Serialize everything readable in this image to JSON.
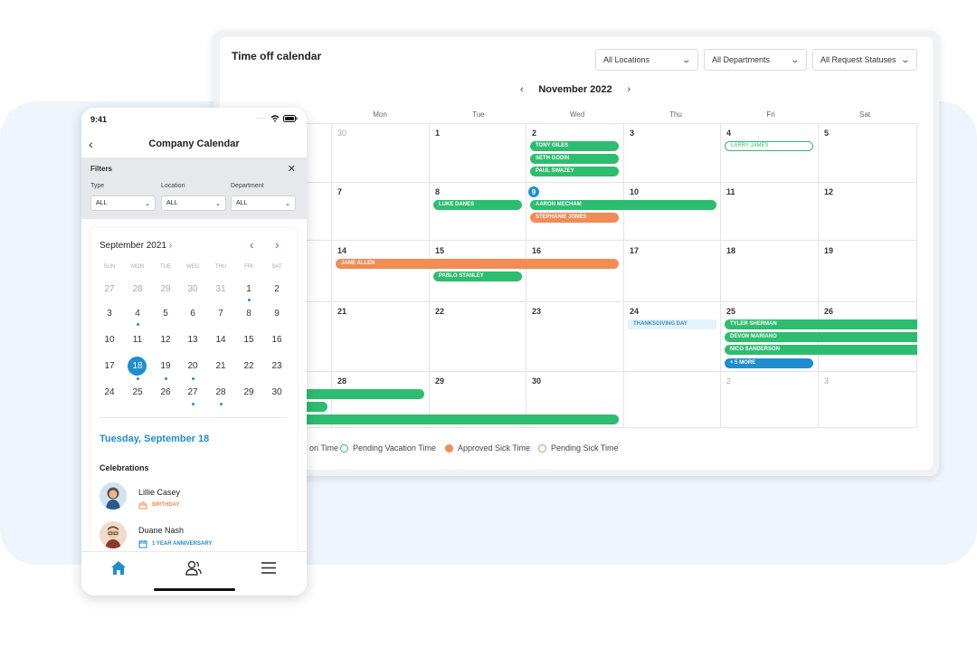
{
  "desktop": {
    "title": "Time off calendar",
    "filters": [
      "All Locations",
      "All Departments",
      "All Request Statuses"
    ],
    "month": "November 2022",
    "weekdays": [
      "Mon",
      "Tue",
      "Wed",
      "Thu",
      "Fri",
      "Sat"
    ],
    "weeks": [
      [
        "",
        "30",
        "1",
        "2",
        "3",
        "4",
        "5"
      ],
      [
        "",
        "7",
        "8",
        "9",
        "10",
        "11",
        "12"
      ],
      [
        "",
        "14",
        "15",
        "16",
        "17",
        "18",
        "19"
      ],
      [
        "",
        "21",
        "22",
        "23",
        "24",
        "25",
        "26"
      ],
      [
        "",
        "28",
        "29",
        "30",
        "",
        "2",
        "3"
      ]
    ],
    "events": {
      "tony_giles": "TONY GILES",
      "seth_godin": "SETH GODIN",
      "paul_swazey": "PAUL SWAZEY",
      "larry_james": "Larry James",
      "luke_danes": "LUKE DANES",
      "aaron_mecham": "AARON MECHAM",
      "stephanie_jones": "STEPHANIE JONES",
      "jane_allen": "JANE ALLEN",
      "pablo_stanley": "PABLO STANLEY",
      "thanksgiving": "THANKSGIVING DAY",
      "tyler_sherman": "TYLER SHERMAN",
      "devon_mariano": "DEVON MARIANO",
      "nico_sanderson": "NICO SANDERSON",
      "more": "+ 5 MORE"
    },
    "legend": [
      "on Time",
      "Pending Vacation Time",
      "Approved Sick Time",
      "Pending Sick Time"
    ],
    "colors": {
      "green": "#2dbd6e",
      "orange": "#f28b54",
      "blue": "#1e8ecf"
    }
  },
  "phone": {
    "time": "9:41",
    "title": "Company Calendar",
    "filters_label": "Filters",
    "filter_cols": [
      {
        "label": "Type",
        "value": "ALL"
      },
      {
        "label": "Location",
        "value": "ALL"
      },
      {
        "label": "Department",
        "value": "ALL"
      }
    ],
    "month": "September 2021",
    "weekdays": [
      "SUN",
      "MON",
      "TUE",
      "WED",
      "THU",
      "FRI",
      "SAT"
    ],
    "weeks": [
      [
        "27",
        "28",
        "29",
        "30",
        "31",
        "1",
        "2"
      ],
      [
        "3",
        "4",
        "5",
        "6",
        "7",
        "8",
        "9"
      ],
      [
        "10",
        "11",
        "12",
        "13",
        "14",
        "15",
        "16"
      ],
      [
        "17",
        "18",
        "19",
        "20",
        "21",
        "22",
        "23"
      ],
      [
        "24",
        "25",
        "26",
        "27",
        "28",
        "29",
        "30"
      ]
    ],
    "selected_date": "Tuesday, September 18",
    "celebrations_label": "Celebrations",
    "people": [
      {
        "name": "Lillie Casey",
        "tag": "BIRTHDAY",
        "icon": "cake-icon"
      },
      {
        "name": "Duane Nash",
        "tag": "1 YEAR ANNIVERSARY",
        "icon": "calendar-icon"
      }
    ]
  }
}
